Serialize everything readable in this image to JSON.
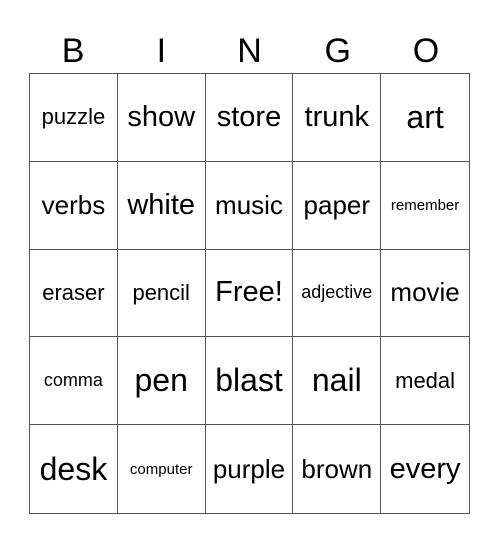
{
  "header": [
    "B",
    "I",
    "N",
    "G",
    "O"
  ],
  "cells": [
    {
      "text": "puzzle",
      "size": "s4"
    },
    {
      "text": "show",
      "size": "s2"
    },
    {
      "text": "store",
      "size": "s2"
    },
    {
      "text": "trunk",
      "size": "s2"
    },
    {
      "text": "art",
      "size": "s1"
    },
    {
      "text": "verbs",
      "size": "s3"
    },
    {
      "text": "white",
      "size": "s2"
    },
    {
      "text": "music",
      "size": "s3"
    },
    {
      "text": "paper",
      "size": "s3"
    },
    {
      "text": "remember",
      "size": "s6"
    },
    {
      "text": "eraser",
      "size": "s4"
    },
    {
      "text": "pencil",
      "size": "s4"
    },
    {
      "text": "Free!",
      "size": "s2"
    },
    {
      "text": "adjective",
      "size": "s5"
    },
    {
      "text": "movie",
      "size": "s3"
    },
    {
      "text": "comma",
      "size": "s5"
    },
    {
      "text": "pen",
      "size": "s1"
    },
    {
      "text": "blast",
      "size": "s1"
    },
    {
      "text": "nail",
      "size": "s1"
    },
    {
      "text": "medal",
      "size": "s4"
    },
    {
      "text": "desk",
      "size": "s1"
    },
    {
      "text": "computer",
      "size": "s6"
    },
    {
      "text": "purple",
      "size": "s3"
    },
    {
      "text": "brown",
      "size": "s3"
    },
    {
      "text": "every",
      "size": "s2"
    }
  ]
}
